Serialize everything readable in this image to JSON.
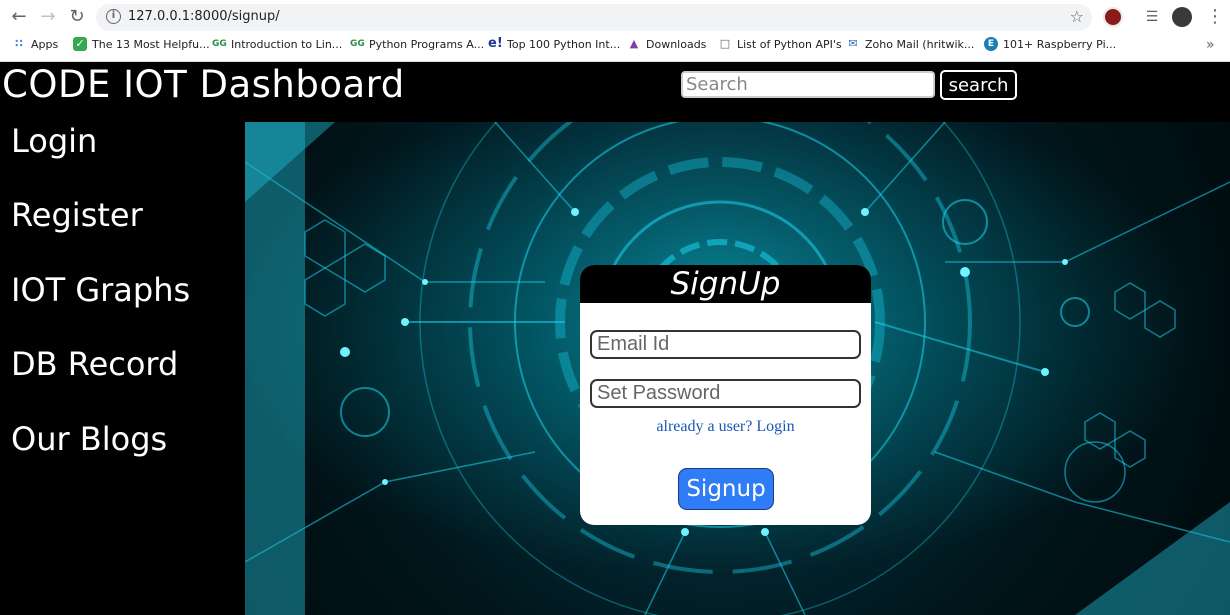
{
  "browser": {
    "url": "127.0.0.1:8000/signup/",
    "bookmarks": [
      {
        "label": "Apps",
        "icon": "apps-grid-icon"
      },
      {
        "label": "The 13 Most Helpfu...",
        "icon": "check-icon"
      },
      {
        "label": "Introduction to Lin...",
        "icon": "gfg-icon"
      },
      {
        "label": "Python Programs A...",
        "icon": "gfg-icon"
      },
      {
        "label": "Top 100 Python Int...",
        "icon": "e-icon"
      },
      {
        "label": "Downloads",
        "icon": "wizard-icon"
      },
      {
        "label": "List of Python API's",
        "icon": "page-icon"
      },
      {
        "label": "Zoho Mail (hritwik...",
        "icon": "mail-icon"
      },
      {
        "label": "101+ Raspberry Pi...",
        "icon": "e-circle-icon"
      }
    ]
  },
  "header": {
    "title": "CODE IOT Dashboard",
    "search_placeholder": "Search",
    "search_button": "search"
  },
  "sidebar": {
    "items": [
      {
        "label": "Login"
      },
      {
        "label": "Register"
      },
      {
        "label": "IOT Graphs"
      },
      {
        "label": "DB Record"
      },
      {
        "label": "Our Blogs"
      }
    ]
  },
  "signup": {
    "title": "SignUp",
    "email_placeholder": "Email Id",
    "password_placeholder": "Set Password",
    "login_link": "already a user? Login",
    "submit": "Signup"
  },
  "colors": {
    "accent": "#2e7cf6",
    "link": "#1a56b8",
    "hero_glow": "#00e5ff"
  }
}
